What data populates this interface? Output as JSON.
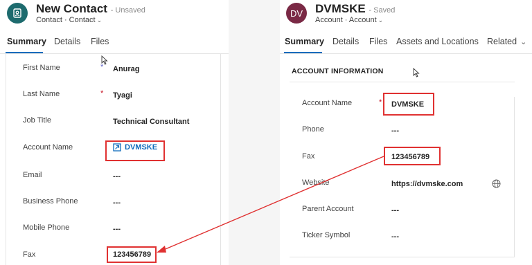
{
  "left": {
    "title": "New Contact",
    "status": "- Unsaved",
    "breadcrumb": "Contact  ·  Contact",
    "tabs": [
      "Summary",
      "Details",
      "Files"
    ],
    "fields": [
      {
        "label": "First Name",
        "value": "Anurag",
        "required": "*"
      },
      {
        "label": "Last Name",
        "value": "Tyagi",
        "required": "*"
      },
      {
        "label": "Job Title",
        "value": "Technical Consultant"
      },
      {
        "label": "Account Name",
        "value": "DVMSKE"
      },
      {
        "label": "Email",
        "value": "---"
      },
      {
        "label": "Business Phone",
        "value": "---"
      },
      {
        "label": "Mobile Phone",
        "value": "---"
      },
      {
        "label": "Fax",
        "value": "123456789"
      }
    ]
  },
  "right": {
    "avatar_initials": "DV",
    "title": "DVMSKE",
    "status": "- Saved",
    "breadcrumb": "Account  ·  Account",
    "tabs": [
      "Summary",
      "Details",
      "Files",
      "Assets and Locations",
      "Related"
    ],
    "section_title": "ACCOUNT INFORMATION",
    "fields": [
      {
        "label": "Account Name",
        "value": "DVMSKE",
        "required": "*"
      },
      {
        "label": "Phone",
        "value": "---"
      },
      {
        "label": "Fax",
        "value": "123456789"
      },
      {
        "label": "Website",
        "value": "https://dvmske.com"
      },
      {
        "label": "Parent Account",
        "value": "---"
      },
      {
        "label": "Ticker Symbol",
        "value": "---"
      }
    ]
  },
  "colors": {
    "accent": "#0f6cbd",
    "highlight": "#e03131",
    "contact_avatar": "#1d6b6e",
    "account_avatar": "#7a2945"
  },
  "icons": [
    "contact-form-icon",
    "chevron-down-icon",
    "account-lookup-icon",
    "globe-icon",
    "mouse-cursor-icon"
  ]
}
